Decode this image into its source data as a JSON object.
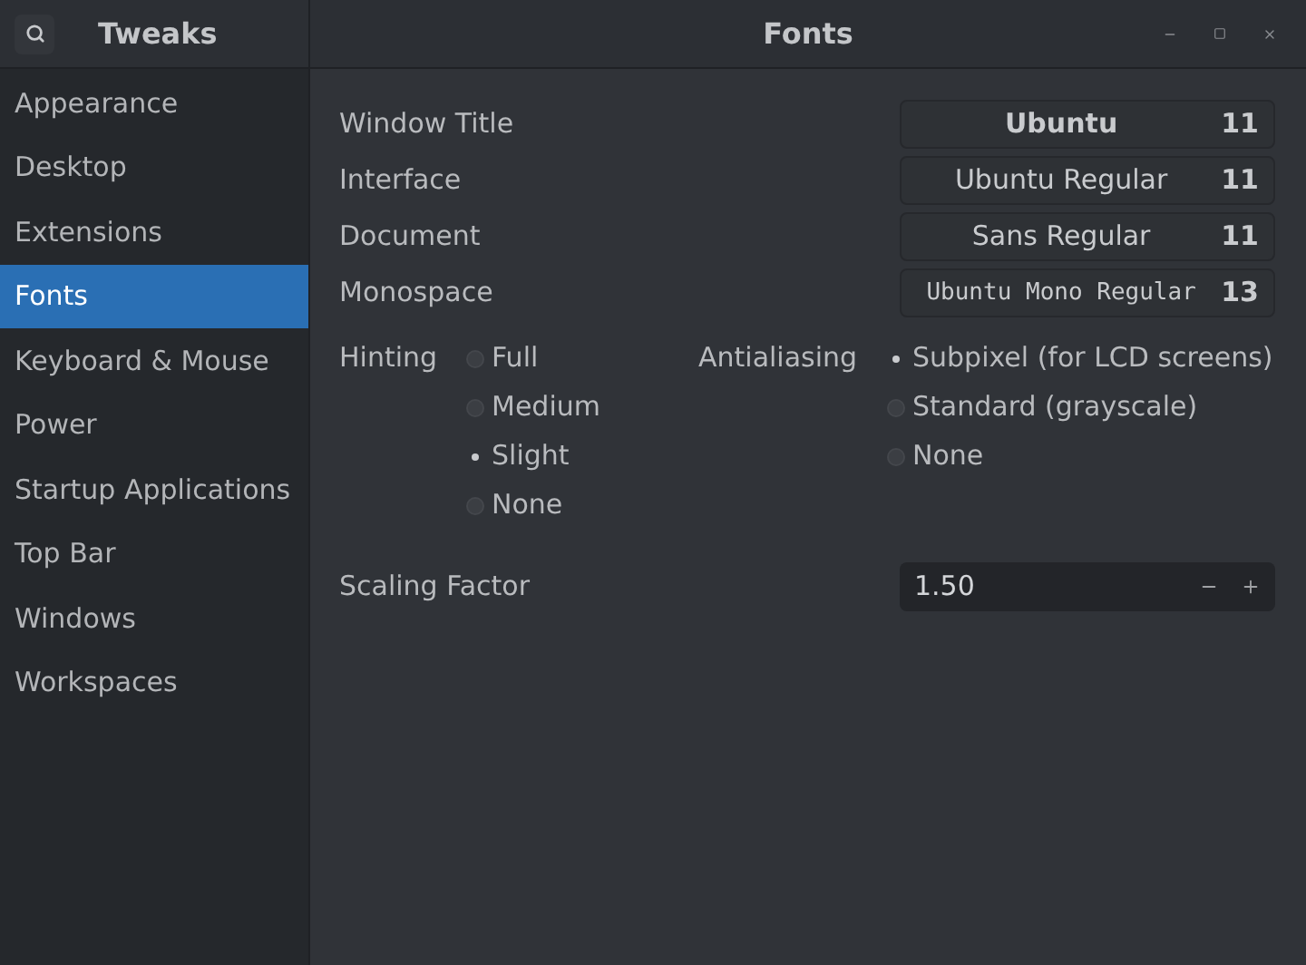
{
  "app_title": "Tweaks",
  "window": {
    "title": "Fonts"
  },
  "sidebar": {
    "items": [
      {
        "label": "Appearance",
        "selected": false
      },
      {
        "label": "Desktop",
        "selected": false
      },
      {
        "label": "Extensions",
        "selected": false
      },
      {
        "label": "Fonts",
        "selected": true
      },
      {
        "label": "Keyboard & Mouse",
        "selected": false
      },
      {
        "label": "Power",
        "selected": false
      },
      {
        "label": "Startup Applications",
        "selected": false
      },
      {
        "label": "Top Bar",
        "selected": false
      },
      {
        "label": "Windows",
        "selected": false
      },
      {
        "label": "Workspaces",
        "selected": false
      }
    ]
  },
  "fonts": [
    {
      "label": "Window Title",
      "font": "Ubuntu",
      "size": "11",
      "kind": "bold"
    },
    {
      "label": "Interface",
      "font": "Ubuntu Regular",
      "size": "11",
      "kind": "regular"
    },
    {
      "label": "Document",
      "font": "Sans Regular",
      "size": "11",
      "kind": "regular"
    },
    {
      "label": "Monospace",
      "font": "Ubuntu Mono Regular",
      "size": "13",
      "kind": "mono"
    }
  ],
  "hinting": {
    "label": "Hinting",
    "options": [
      {
        "label": "Full",
        "selected": false
      },
      {
        "label": "Medium",
        "selected": false
      },
      {
        "label": "Slight",
        "selected": true
      },
      {
        "label": "None",
        "selected": false
      }
    ]
  },
  "antialiasing": {
    "label": "Antialiasing",
    "options": [
      {
        "label": "Subpixel (for LCD screens)",
        "selected": true
      },
      {
        "label": "Standard (grayscale)",
        "selected": false
      },
      {
        "label": "None",
        "selected": false
      }
    ]
  },
  "scaling": {
    "label": "Scaling Factor",
    "value": "1.50"
  }
}
